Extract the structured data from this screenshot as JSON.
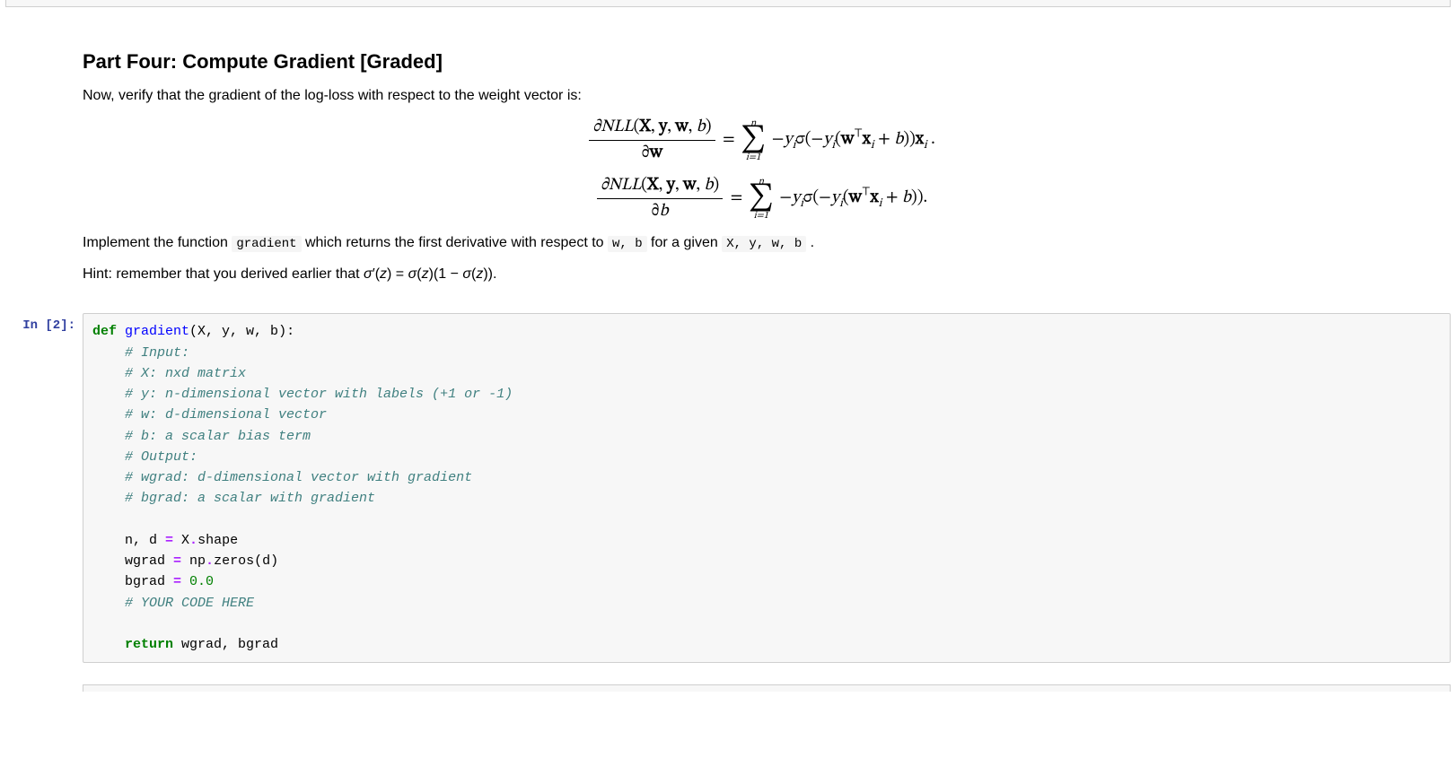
{
  "md": {
    "heading": "Part Four: Compute Gradient [Graded]",
    "intro": "Now, verify that the gradient of the log-loss with respect to the weight vector is:",
    "eq1": {
      "lhs_num": "∂NLL(X, y, w, b)",
      "lhs_den": "∂w",
      "sum_top": "n",
      "sum_bot": "i=1",
      "rhs": "− yᵢ σ(−yᵢ (wᵀxᵢ + b)) xᵢ ."
    },
    "eq2": {
      "lhs_num": "∂NLL(X, y, w, b)",
      "lhs_den": "∂b",
      "sum_top": "n",
      "sum_bot": "i=1",
      "rhs": "− yᵢ σ(−yᵢ (wᵀxᵢ + b))."
    },
    "impl_pre": "Implement the function ",
    "impl_code1": "gradient",
    "impl_mid": " which returns the first derivative with respect to ",
    "impl_code2": "w, b",
    "impl_mid2": " for a given ",
    "impl_code3": "X, y, w, b",
    "impl_post": " .",
    "hint": "Hint: remember that you derived earlier that σ′(z) = σ(z)(1 − σ(z))."
  },
  "code": {
    "prompt": "In [2]:",
    "line01_kw": "def",
    "line01_fn": "gradient",
    "line01_rest": "(X, y, w, b):",
    "line02": "    # Input:",
    "line03": "    # X: nxd matrix",
    "line04": "    # y: n-dimensional vector with labels (+1 or -1)",
    "line05": "    # w: d-dimensional vector",
    "line06": "    # b: a scalar bias term",
    "line07": "    # Output:",
    "line08": "    # wgrad: d-dimensional vector with gradient",
    "line09": "    # bgrad: a scalar with gradient",
    "line10": "",
    "line11a": "    n, d ",
    "line11op": "=",
    "line11b": " X",
    "line11dot": ".",
    "line11c": "shape",
    "line12a": "    wgrad ",
    "line12op": "=",
    "line12b": " np",
    "line12dot": ".",
    "line12c": "zeros(d)",
    "line13a": "    bgrad ",
    "line13op": "=",
    "line13b": " ",
    "line13num": "0.0",
    "line14": "    # YOUR CODE HERE",
    "line15": "",
    "line16kw": "    return",
    "line16rest": " wgrad, bgrad"
  }
}
